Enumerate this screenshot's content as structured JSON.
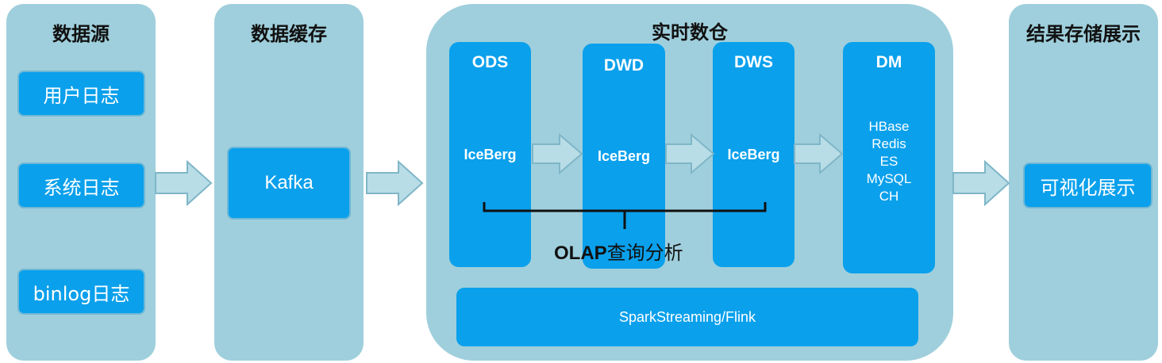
{
  "panels": {
    "source": {
      "title": "数据源",
      "items": [
        "用户日志",
        "系统日志",
        "binlog日志"
      ]
    },
    "cache": {
      "title": "数据缓存",
      "item": "Kafka"
    },
    "warehouse": {
      "title": "实时数仓",
      "layers": [
        {
          "name": "ODS",
          "content": "IceBerg"
        },
        {
          "name": "DWD",
          "content": "IceBerg"
        },
        {
          "name": "DWS",
          "content": "IceBerg"
        },
        {
          "name": "DM",
          "items": [
            "HBase",
            "Redis",
            "ES",
            "MySQL",
            "CH"
          ]
        }
      ],
      "olap_prefix": "OLAP",
      "olap_suffix": "查询分析",
      "engine": "SparkStreaming/Flink"
    },
    "result": {
      "title": "结果存储展示",
      "item": "可视化展示"
    }
  },
  "colors": {
    "panel": "#9fcfdc",
    "box": "#0aa0ec",
    "arrow_fill": "#b8dde6",
    "arrow_stroke": "#7fb6c8"
  }
}
